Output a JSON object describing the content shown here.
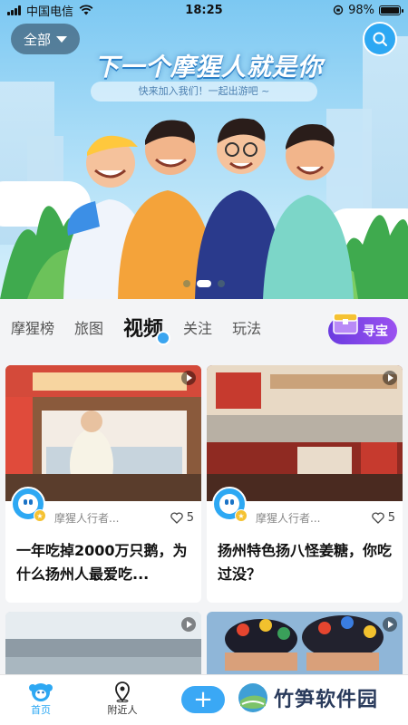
{
  "status_bar": {
    "carrier": "中国电信",
    "time": "18:25",
    "battery": "98%",
    "battery_level": 0.98
  },
  "banner": {
    "filter_label": "全部",
    "headline": "下一个摩猩人就是你",
    "subline": "快来加入我们！一起出游吧 ~",
    "slide_count": 3,
    "active_slide": 1
  },
  "tabs": [
    {
      "label": "摩猩榜"
    },
    {
      "label": "旅图"
    },
    {
      "label": "视频",
      "active": true
    },
    {
      "label": "关注"
    },
    {
      "label": "玩法"
    }
  ],
  "treasure_label": "寻宝",
  "cards": [
    {
      "author": "摩猩人行者...",
      "likes": "5",
      "title": "一年吃掉2000万只鹅，为什么扬州人最爱吃..."
    },
    {
      "author": "摩猩人行者...",
      "likes": "5",
      "title": "扬州特色扬八怪姜糖，你吃过没？"
    },
    {
      "author": "",
      "likes": "",
      "title": ""
    },
    {
      "author": "",
      "likes": "",
      "title": ""
    }
  ],
  "bottom_nav": {
    "home_label": "首页",
    "nearby_label": "附近人",
    "add_label": "+"
  },
  "watermark": "竹笋软件园",
  "colors": {
    "accent": "#2da8f3",
    "treasure": "#7b45e8"
  }
}
